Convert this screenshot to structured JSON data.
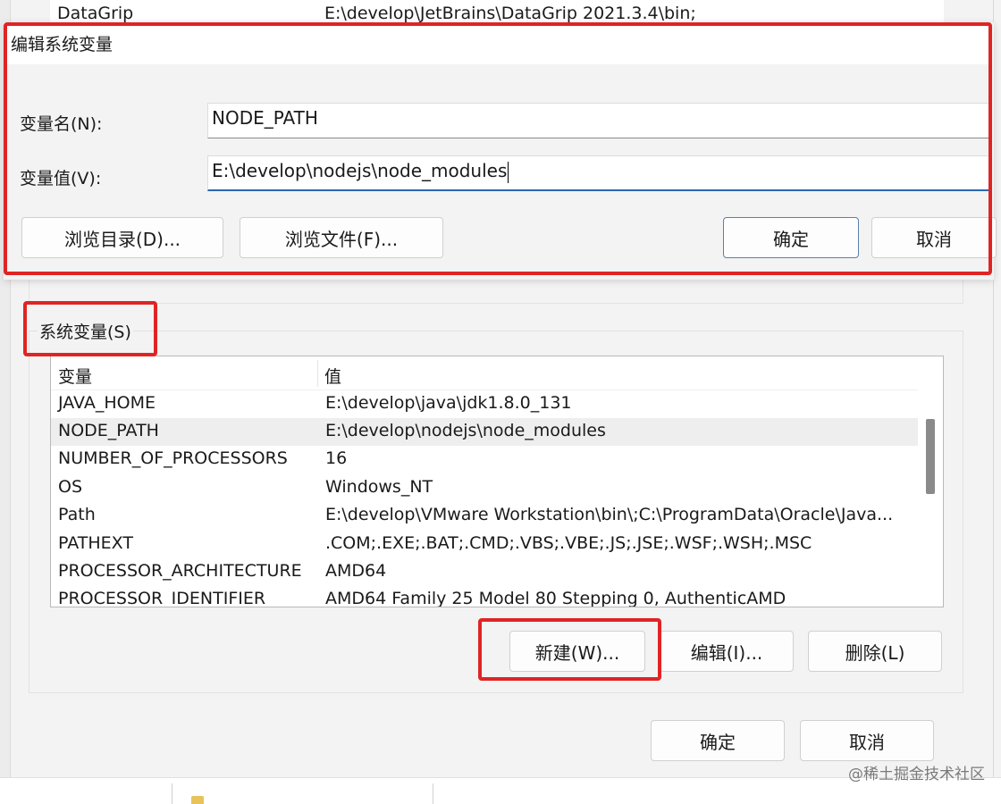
{
  "background": {
    "top_row": {
      "name": "DataGrip",
      "value": "E:\\develop\\JetBrains\\DataGrip 2021.3.4\\bin;"
    }
  },
  "dialog": {
    "title": "编辑系统变量",
    "name_label": "变量名(N):",
    "value_label": "变量值(V):",
    "name_value": "NODE_PATH",
    "value_value": "E:\\develop\\nodejs\\node_modules",
    "browse_dir": "浏览目录(D)...",
    "browse_file": "浏览文件(F)...",
    "ok": "确定",
    "cancel": "取消"
  },
  "system_vars": {
    "title": "系统变量(S)",
    "col_var": "变量",
    "col_val": "值",
    "rows": [
      {
        "name": "JAVA_HOME",
        "value": "E:\\develop\\java\\jdk1.8.0_131"
      },
      {
        "name": "NODE_PATH",
        "value": "E:\\develop\\nodejs\\node_modules"
      },
      {
        "name": "NUMBER_OF_PROCESSORS",
        "value": "16"
      },
      {
        "name": "OS",
        "value": "Windows_NT"
      },
      {
        "name": "Path",
        "value": "E:\\develop\\VMware Workstation\\bin\\;C:\\ProgramData\\Oracle\\Java..."
      },
      {
        "name": "PATHEXT",
        "value": ".COM;.EXE;.BAT;.CMD;.VBS;.VBE;.JS;.JSE;.WSF;.WSH;.MSC"
      },
      {
        "name": "PROCESSOR_ARCHITECTURE",
        "value": "AMD64"
      },
      {
        "name": "PROCESSOR_IDENTIFIER",
        "value": "AMD64 Family 25 Model 80 Stepping 0, AuthenticAMD"
      }
    ],
    "new_btn": "新建(W)...",
    "edit_btn": "编辑(I)...",
    "delete_btn": "删除(L)"
  },
  "window_buttons": {
    "ok": "确定",
    "cancel": "取消"
  },
  "watermark": "@稀土掘金技术社区",
  "colors": {
    "highlight": "#e02424",
    "focus": "#2b66b1",
    "selected_row": "#eeeeee"
  }
}
